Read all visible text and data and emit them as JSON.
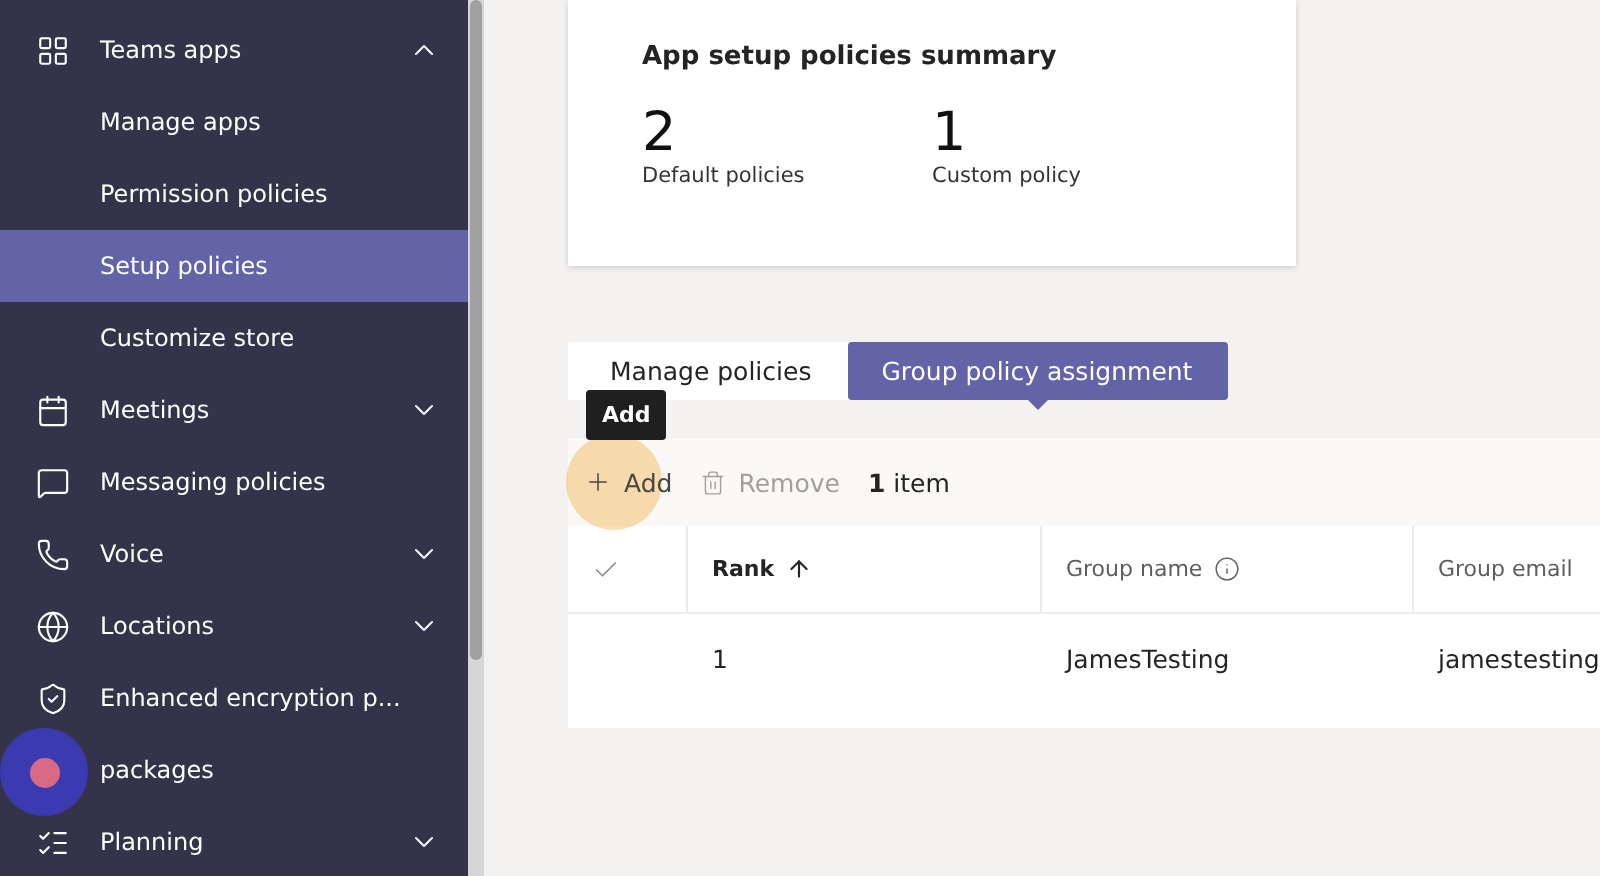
{
  "sidebar": {
    "items": [
      {
        "label": "Teams apps",
        "kind": "group",
        "expanded": true,
        "selected": false
      },
      {
        "label": "Manage apps",
        "kind": "sub",
        "selected": false
      },
      {
        "label": "Permission policies",
        "kind": "sub",
        "selected": false
      },
      {
        "label": "Setup policies",
        "kind": "sub",
        "selected": true
      },
      {
        "label": "Customize store",
        "kind": "sub",
        "selected": false
      },
      {
        "label": "Meetings",
        "kind": "group",
        "expanded": false,
        "selected": false
      },
      {
        "label": "Messaging policies",
        "kind": "group",
        "selected": false
      },
      {
        "label": "Voice",
        "kind": "group",
        "expanded": false,
        "selected": false
      },
      {
        "label": "Locations",
        "kind": "group",
        "expanded": false,
        "selected": false
      },
      {
        "label": "Enhanced encryption p...",
        "kind": "group",
        "selected": false
      },
      {
        "label": "packages",
        "kind": "group",
        "selected": false
      },
      {
        "label": "Planning",
        "kind": "group",
        "expanded": false,
        "selected": false
      }
    ]
  },
  "summary": {
    "title": "App setup policies summary",
    "stats": [
      {
        "value": "2",
        "label": "Default policies"
      },
      {
        "value": "1",
        "label": "Custom policy"
      }
    ]
  },
  "tabs": [
    {
      "label": "Manage policies",
      "selected": false
    },
    {
      "label": "Group policy assignment",
      "selected": true
    }
  ],
  "toolbar": {
    "tooltip": "Add",
    "add": "Add",
    "remove": "Remove",
    "count_bold": "1",
    "count": "item"
  },
  "table": {
    "columns": [
      "Rank",
      "Group name",
      "Group email"
    ],
    "rows": [
      [
        "1",
        "JamesTesting",
        "jamestesting"
      ]
    ]
  }
}
